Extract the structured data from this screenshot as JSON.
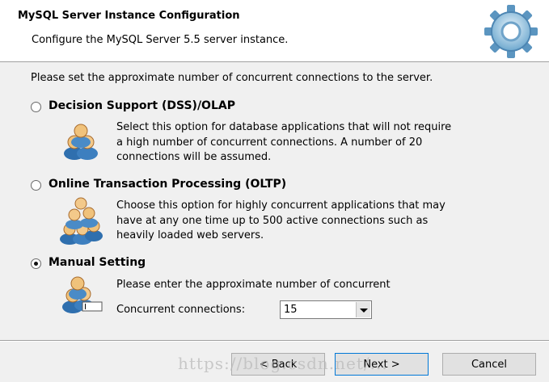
{
  "header": {
    "title": "MySQL Server Instance Configuration",
    "subtitle": "Configure the MySQL Server 5.5 server instance."
  },
  "instruction": "Please set the approximate number of concurrent connections to the server.",
  "options": [
    {
      "label": "Decision Support (DSS)/OLAP",
      "desc_lines": [
        "Select this option for database applications that will not require",
        "a high number of concurrent connections. A number of 20",
        "connections will be assumed."
      ],
      "selected": false
    },
    {
      "label": "Online Transaction Processing (OLTP)",
      "desc_lines": [
        "Choose this option for highly concurrent applications that may",
        "have at any one time up to 500 active connections such as",
        "heavily loaded web servers."
      ],
      "selected": false
    },
    {
      "label": "Manual Setting",
      "desc_lines": [
        "Please enter the approximate number of concurrent"
      ],
      "selected": true
    }
  ],
  "concurrent": {
    "label": "Concurrent connections:",
    "value": "15"
  },
  "buttons": {
    "back": "< Back",
    "next": "Next >",
    "cancel": "Cancel"
  },
  "watermark": "https://blog.csdn.net/..."
}
